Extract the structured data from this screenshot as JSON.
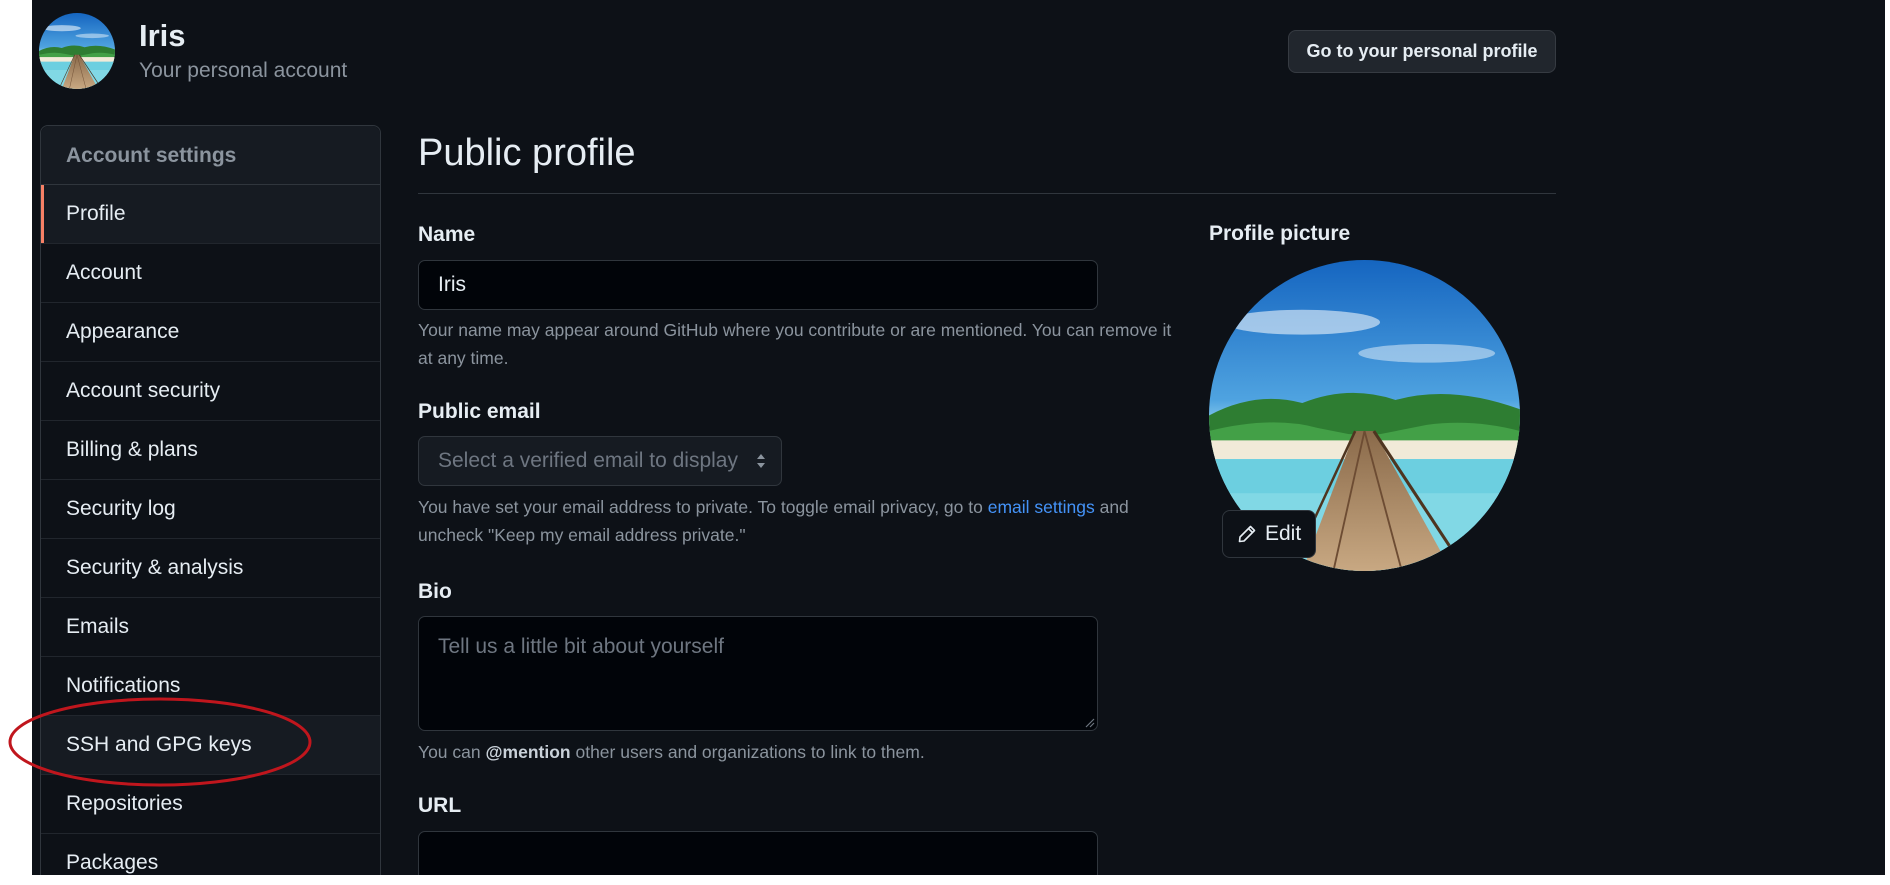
{
  "header": {
    "username": "Iris",
    "subtitle": "Your personal account",
    "profile_button": "Go to your personal profile"
  },
  "sidebar": {
    "heading": "Account settings",
    "items": [
      {
        "label": "Profile",
        "active": true
      },
      {
        "label": "Account"
      },
      {
        "label": "Appearance"
      },
      {
        "label": "Account security"
      },
      {
        "label": "Billing & plans"
      },
      {
        "label": "Security log"
      },
      {
        "label": "Security & analysis"
      },
      {
        "label": "Emails"
      },
      {
        "label": "Notifications"
      },
      {
        "label": "SSH and GPG keys",
        "highlighted": true
      },
      {
        "label": "Repositories"
      },
      {
        "label": "Packages"
      }
    ]
  },
  "main": {
    "title": "Public profile",
    "name": {
      "label": "Name",
      "value": "Iris",
      "help": "Your name may appear around GitHub where you contribute or are mentioned. You can remove it at any time."
    },
    "public_email": {
      "label": "Public email",
      "placeholder": "Select a verified email to display",
      "help_before": "You have set your email address to private. To toggle email privacy, go to ",
      "help_link": "email settings",
      "help_after": " and uncheck \"Keep my email address private.\""
    },
    "bio": {
      "label": "Bio",
      "placeholder": "Tell us a little bit about yourself",
      "help_before": "You can ",
      "help_bold": "@mention",
      "help_after": " other users and organizations to link to them."
    },
    "url": {
      "label": "URL",
      "value": ""
    },
    "profile_picture": {
      "label": "Profile picture",
      "edit_label": "Edit"
    }
  },
  "colors": {
    "background": "#0d1117",
    "sidebar_active_marker": "#f78166",
    "link": "#4493f8",
    "annotation_ellipse": "#c0161d"
  },
  "icons": [
    "pencil-icon",
    "select-chevron-icon",
    "resize-handle-icon"
  ]
}
